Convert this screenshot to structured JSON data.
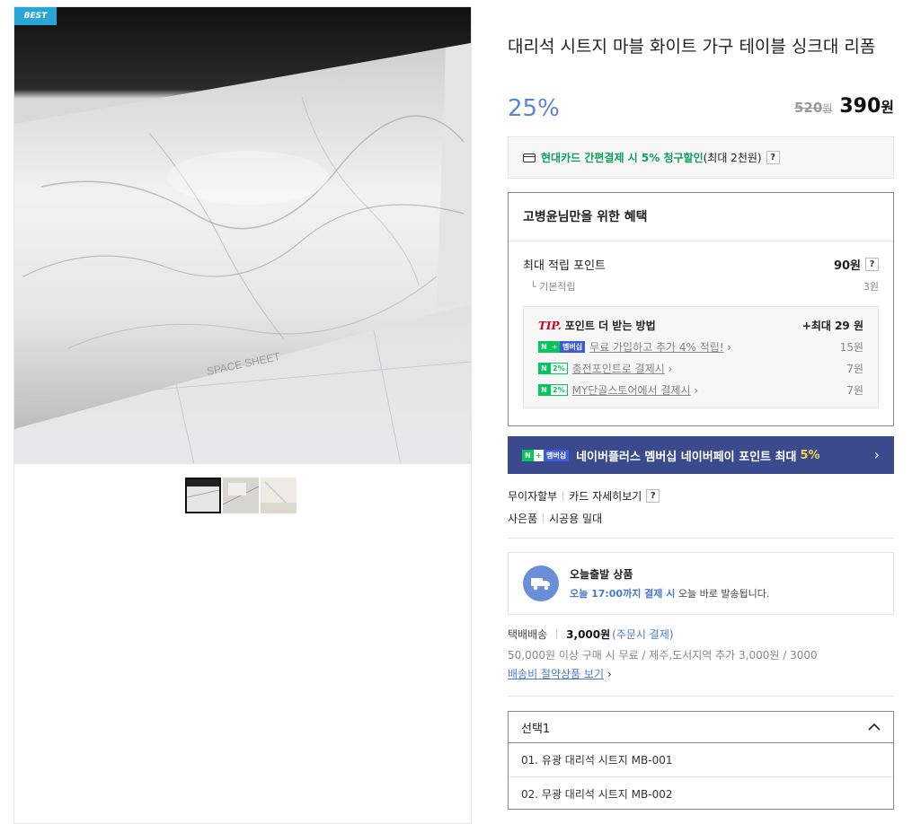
{
  "badge": "BEST",
  "product": {
    "title": "대리석 시트지 마블 화이트 가구 테이블 싱크대 리폼",
    "discount": "25%",
    "original_price": "520",
    "original_unit": "원",
    "price": "390",
    "price_unit": "원"
  },
  "card_promo": {
    "highlight": "현대카드 간편결제 시 5% 청구할인",
    "rest": " (최대 2천원)",
    "help": "?"
  },
  "benefit": {
    "title": "고병윤님만을 위한 혜택",
    "max_point_label": "최대 적립 포인트",
    "max_point_value": "90원",
    "help": "?",
    "base_label": "기본적립",
    "base_value": "3원",
    "tip": {
      "tip_word": "TIP.",
      "title": "포인트 더 받는 방법",
      "max": "+최대 29 원",
      "rows": [
        {
          "badge": "멤버십",
          "label": "무료 가입하고 추가 4% 적립!",
          "value": "15원"
        },
        {
          "badge": "2%",
          "label": "충전포인트로 결제시",
          "value": "7원"
        },
        {
          "badge": "2%",
          "label": "MY단골스토어에서 결제시",
          "value": "7원"
        }
      ]
    }
  },
  "naver_bar": {
    "badge": "멤버십",
    "text": "네이버플러스 멤버십 네이버페이 포인트 최대",
    "highlight": "5%",
    "arrow": "›"
  },
  "info": {
    "installment": "무이자할부",
    "card_detail": "카드 자세히보기",
    "help": "?",
    "gift": "사은품",
    "gift_value": "시공용 밀대"
  },
  "today_ship": {
    "title": "오늘출발 상품",
    "time": "오늘 17:00까지 결제 시",
    "rest": " 오늘 바로 발송됩니다."
  },
  "shipping": {
    "method": "택배배송",
    "fee": "3,000원",
    "fee_note": "(주문시 결제)",
    "condition": "50,000원 이상 구매 시 무료 / 제주,도서지역 추가 3,000원 / 3000",
    "link": "배송비 절약상품 보기",
    "chev": "›"
  },
  "option_select": {
    "label": "선택1",
    "options": [
      "01. 유광 대리석 시트지 MB-001",
      "02. 무광 대리석 시트지 MB-002"
    ]
  },
  "icons": {
    "truck": "truck-icon",
    "card": "credit-card-icon",
    "chevron_up": "chevron-up-icon"
  }
}
